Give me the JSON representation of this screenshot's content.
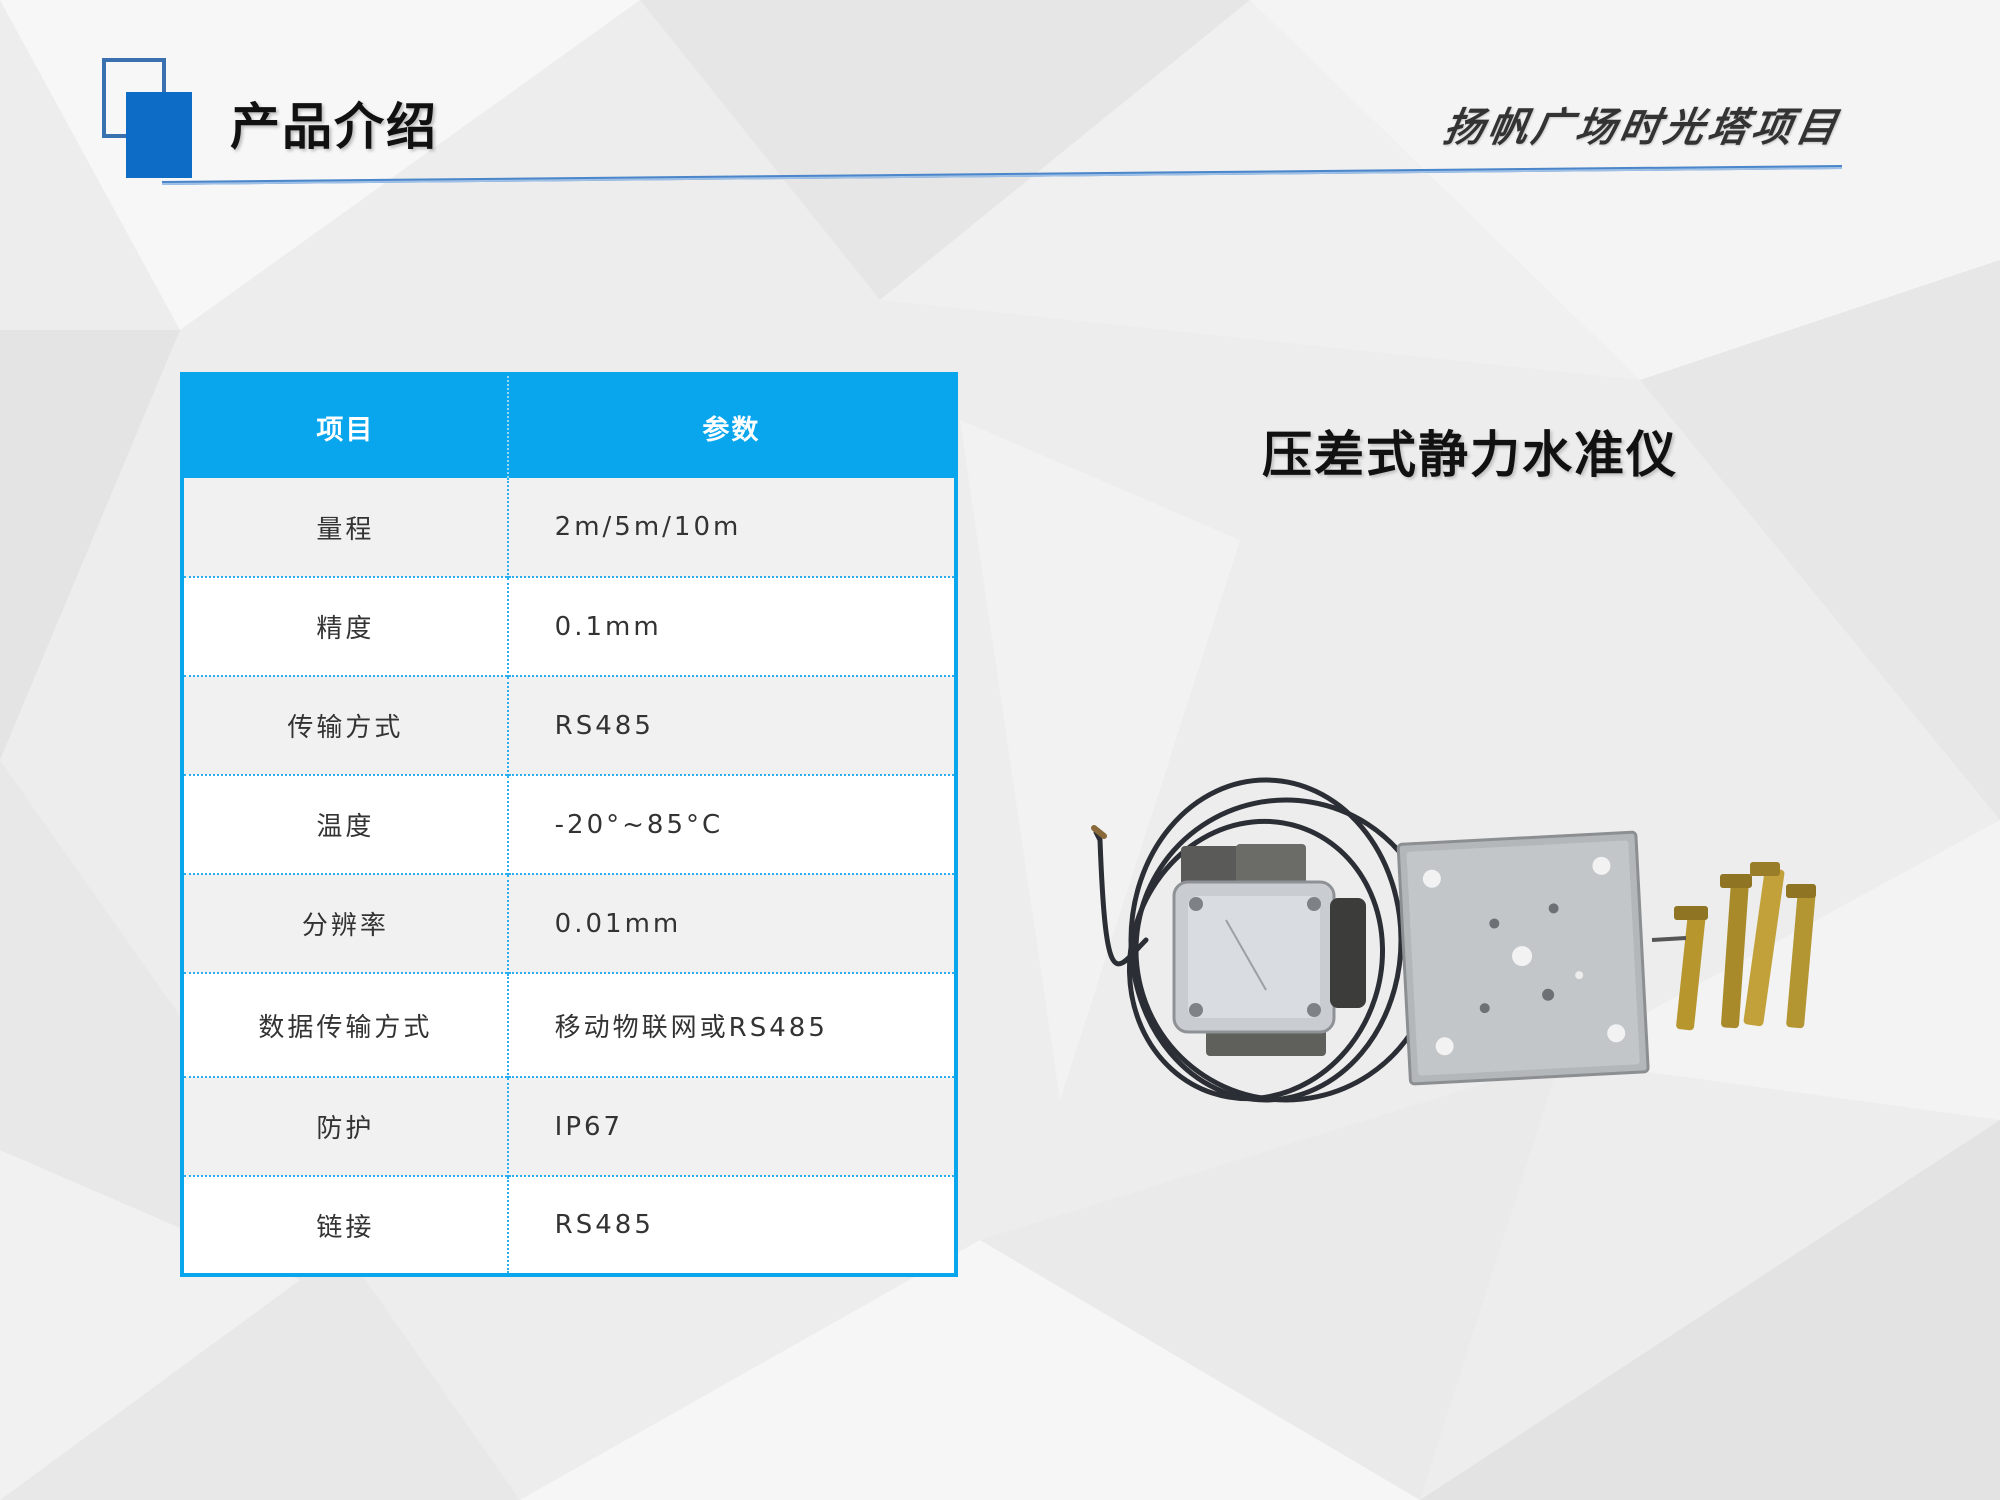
{
  "header": {
    "title": "产品介绍",
    "project": "扬帆广场时光塔项目"
  },
  "table": {
    "headers": {
      "item": "项目",
      "value": "参数"
    },
    "rows": [
      {
        "item": "量程",
        "value": "2m/5m/10m"
      },
      {
        "item": "精度",
        "value": "0.1mm"
      },
      {
        "item": "传输方式",
        "value": "RS485"
      },
      {
        "item": "温度",
        "value": "-20°~85°C"
      },
      {
        "item": "分辨率",
        "value": "0.01mm"
      },
      {
        "item": "数据传输方式",
        "value": "移动物联网或RS485"
      },
      {
        "item": "防护",
        "value": "IP67"
      },
      {
        "item": "链接",
        "value": "RS485"
      }
    ]
  },
  "product": {
    "title": "压差式静力水准仪"
  },
  "colors": {
    "accent": "#09a6ee",
    "logo_blue": "#0c6cc6",
    "title_text": "#111111"
  }
}
